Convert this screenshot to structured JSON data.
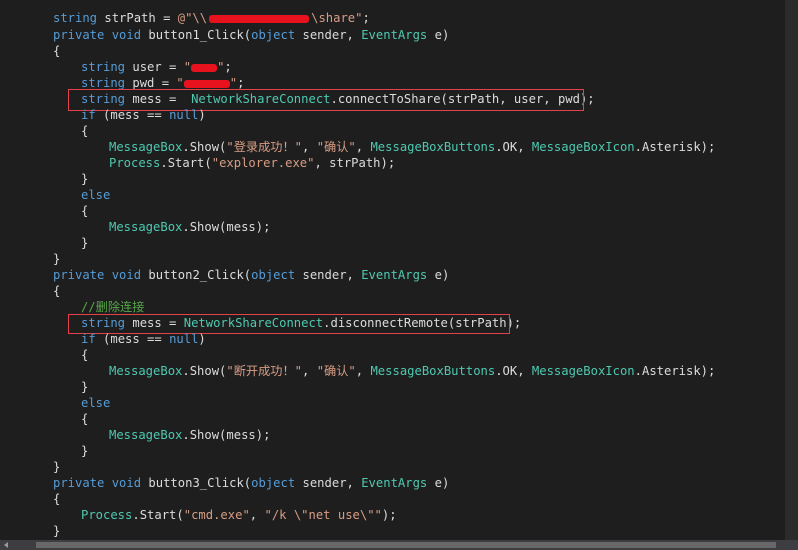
{
  "colors": {
    "background": "#1e1e1e",
    "keyword": "#569cd6",
    "type": "#4ec9b0",
    "string": "#d69d85",
    "comment": "#57a64a",
    "text": "#dcdcdc",
    "highlight_border": "#e2424a",
    "redaction": "#e8121f"
  },
  "code": {
    "l1": {
      "kw": "string",
      "a": " strPath = ",
      "s1": "@\"\\\\",
      "s2": "\\share\"",
      "b": ";"
    },
    "l2": {
      "kw1": "private",
      "kw2": "void",
      "a": " button1_Click(",
      "kw3": "object",
      "b": " sender, ",
      "ty": "EventArgs",
      "c": " e)"
    },
    "l3": "{",
    "l4": {
      "kw": "string",
      "a": " user = ",
      "s1": "\"",
      "s2": "\"",
      "b": ";"
    },
    "l5": {
      "kw": "string",
      "a": " pwd = ",
      "s1": "\"",
      "s2": "\"",
      "b": ";"
    },
    "l6": {
      "kw": "string",
      "a": " mess =  ",
      "ty": "NetworkShareConnect",
      "b": ".connectToShare(strPath, user, pwd);"
    },
    "l7": {
      "kw": "if",
      "a": " (mess == ",
      "kw2": "null",
      "b": ")"
    },
    "l8": "{",
    "l9": {
      "ty": "MessageBox",
      "a": ".Show(",
      "s1": "\"登录成功！\"",
      "b": ", ",
      "s2": "\"确认\"",
      "c": ", ",
      "ty2": "MessageBoxButtons",
      "d": ".OK, ",
      "ty3": "MessageBoxIcon",
      "e": ".Asterisk);"
    },
    "l10": {
      "ty": "Process",
      "a": ".Start(",
      "s": "\"explorer.exe\"",
      "b": ", strPath);"
    },
    "l11": "}",
    "l12": {
      "kw": "else"
    },
    "l13": "{",
    "l14": {
      "ty": "MessageBox",
      "a": ".Show(mess);"
    },
    "l15": "}",
    "l16": "}",
    "l17": {
      "kw1": "private",
      "kw2": "void",
      "a": " button2_Click(",
      "kw3": "object",
      "b": " sender, ",
      "ty": "EventArgs",
      "c": " e)"
    },
    "l18": "{",
    "l19": {
      "cm": "//删除连接"
    },
    "l20": {
      "kw": "string",
      "a": " mess = ",
      "ty": "NetworkShareConnect",
      "b": ".disconnectRemote(strPath);"
    },
    "l21": {
      "kw": "if",
      "a": " (mess == ",
      "kw2": "null",
      "b": ")"
    },
    "l22": "{",
    "l23": {
      "ty": "MessageBox",
      "a": ".Show(",
      "s1": "\"断开成功！\"",
      "b": ", ",
      "s2": "\"确认\"",
      "c": ", ",
      "ty2": "MessageBoxButtons",
      "d": ".OK, ",
      "ty3": "MessageBoxIcon",
      "e": ".Asterisk);"
    },
    "l24": "}",
    "l25": {
      "kw": "else"
    },
    "l26": "{",
    "l27": {
      "ty": "MessageBox",
      "a": ".Show(mess);"
    },
    "l28": "}",
    "l29": "}",
    "l30": {
      "kw1": "private",
      "kw2": "void",
      "a": " button3_Click(",
      "kw3": "object",
      "b": " sender, ",
      "ty": "EventArgs",
      "c": " e)"
    },
    "l31": "{",
    "l32": {
      "ty": "Process",
      "a": ".Start(",
      "s1": "\"cmd.exe\"",
      "b": ", ",
      "s2": "\"/k \\\"net use\\\"\"",
      "c": ");"
    },
    "l33": "}"
  }
}
